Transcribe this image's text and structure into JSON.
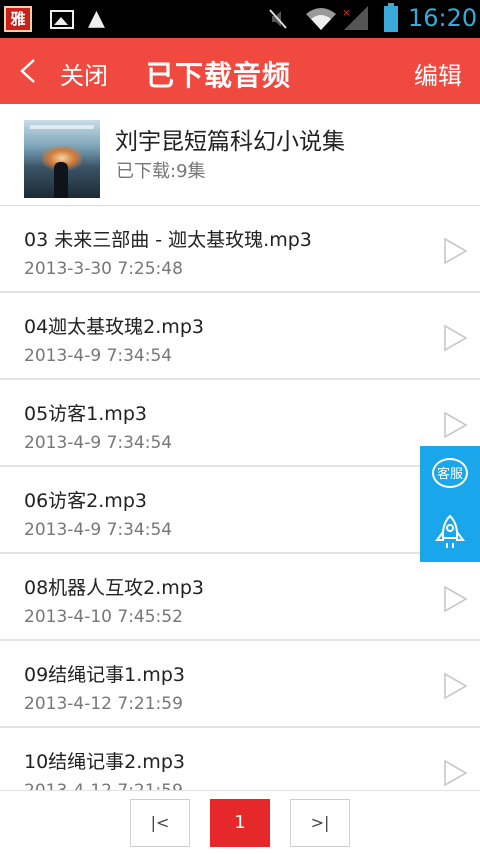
{
  "status_bar": {
    "app_badge": "雅",
    "warning_glyph": "▲",
    "time": "16:20",
    "icons": [
      "app-badge-icon",
      "gallery-icon",
      "warning-icon",
      "mute-icon",
      "wifi-icon",
      "signal-icon",
      "battery-icon"
    ]
  },
  "header": {
    "back_label": "关闭",
    "title": "已下载音频",
    "edit_label": "编辑",
    "background": "#f0493f"
  },
  "album": {
    "title": "刘宇昆短篇科幻小说集",
    "downloaded": "已下载:9集"
  },
  "tracks": [
    {
      "title": "03 未来三部曲 - 迦太基玫瑰.mp3",
      "time": "2013-3-30 7:25:48"
    },
    {
      "title": "04迦太基玫瑰2.mp3",
      "time": "2013-4-9 7:34:54"
    },
    {
      "title": "05访客1.mp3",
      "time": "2013-4-9 7:34:54"
    },
    {
      "title": "06访客2.mp3",
      "time": "2013-4-9 7:34:54"
    },
    {
      "title": "08机器人互攻2.mp3",
      "time": "2013-4-10 7:45:52"
    },
    {
      "title": "09结绳记事1.mp3",
      "time": "2013-4-12 7:21:59"
    },
    {
      "title": "10结绳记事2.mp3",
      "time": "2013-4-12 7:21:59"
    }
  ],
  "float_panel": {
    "service_label": "客服",
    "background": "#1aa6ea"
  },
  "pagination": {
    "first_label": "|<",
    "current_page": "1",
    "last_label": ">|",
    "active_color": "#e6282a"
  }
}
